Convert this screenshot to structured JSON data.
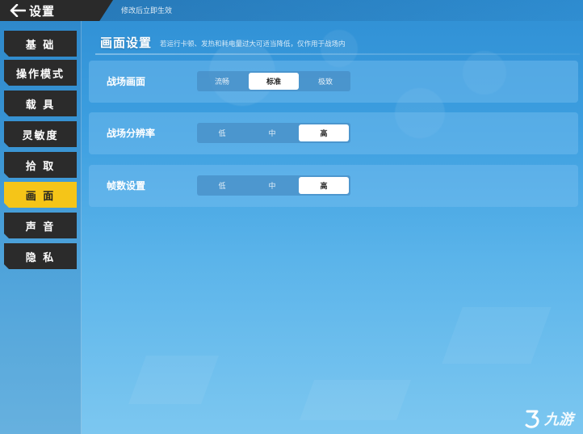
{
  "header": {
    "title": "设置",
    "note": "修改后立即生效"
  },
  "sidebar": {
    "items": [
      {
        "label": "基 础",
        "active": false
      },
      {
        "label": "操作模式",
        "active": false
      },
      {
        "label": "载 具",
        "active": false
      },
      {
        "label": "灵敏度",
        "active": false
      },
      {
        "label": "拾 取",
        "active": false
      },
      {
        "label": "画 面",
        "active": true
      },
      {
        "label": "声 音",
        "active": false
      },
      {
        "label": "隐 私",
        "active": false
      }
    ]
  },
  "main": {
    "section_title": "画面设置",
    "section_note": "若运行卡顿、发热和耗电量过大可适当降低，仅作用于战场内",
    "rows": [
      {
        "label": "战场画面",
        "options": [
          "流畅",
          "标准",
          "极致"
        ],
        "selected": 1
      },
      {
        "label": "战场分辨率",
        "options": [
          "低",
          "中",
          "高"
        ],
        "selected": 2
      },
      {
        "label": "帧数设置",
        "options": [
          "低",
          "中",
          "高"
        ],
        "selected": 2
      }
    ]
  },
  "watermark": {
    "text": "九游"
  },
  "colors": {
    "accent": "#f5c518",
    "sidebar_item": "#2b2b2b",
    "selected_option": "#ffffff"
  }
}
